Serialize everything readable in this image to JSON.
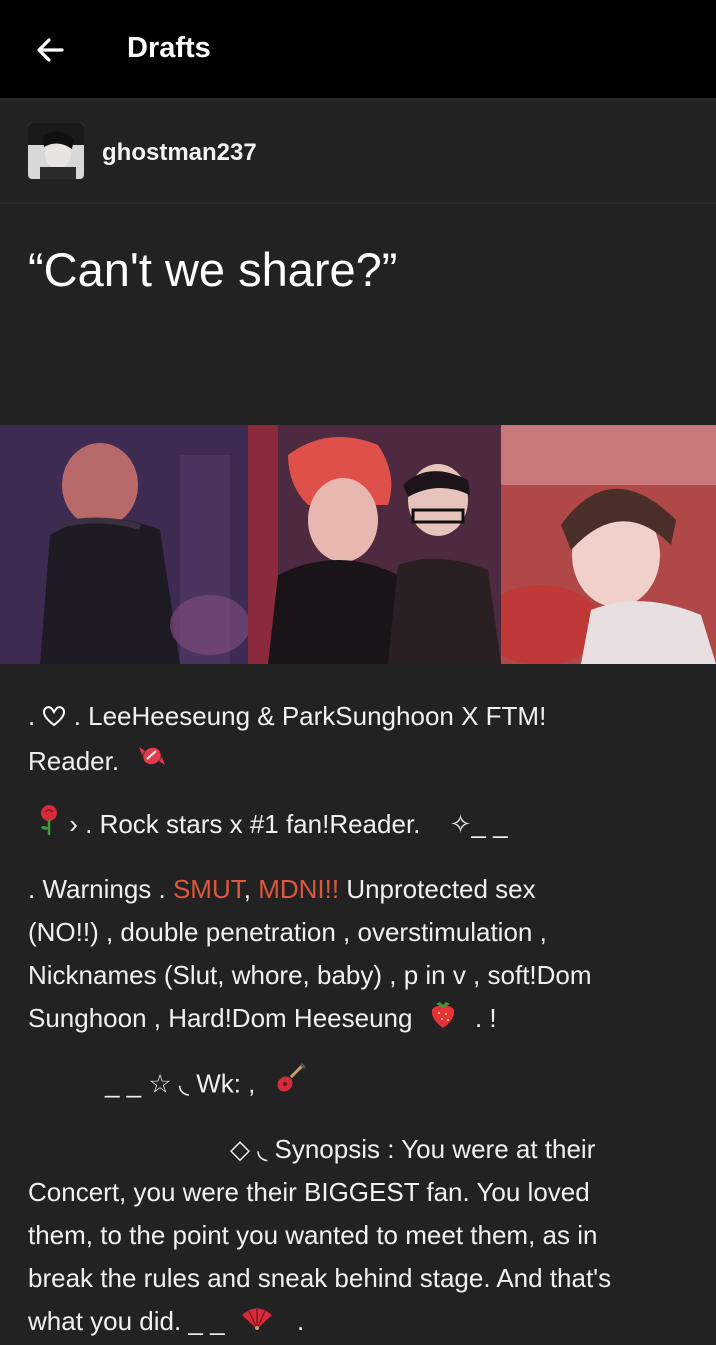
{
  "header": {
    "title": "Drafts",
    "back_icon": "arrow-left-icon"
  },
  "author": {
    "name": "ghostman237"
  },
  "post": {
    "title": "“Can't we share?”",
    "pairing_line_a": ". ",
    "pairing_line_b": " . LeeHeeseung & ParkSunghoon X FTM!",
    "pairing_line_c": "Reader.",
    "rock_line": " › . Rock stars x #1 fan!Reader.",
    "rock_suffix": "✧_ _",
    "warnings_lead": ". Warnings . ",
    "smut": "SMUT",
    "comma": ", ",
    "mdni": "MDNI!!",
    "warnings_rest_1": " Unprotected sex",
    "warnings_line_2": "(NO!!) , double penetration , overstimulation ,",
    "warnings_line_3": "Nicknames (Slut, whore, baby) , p in v , soft!Dom",
    "warnings_line_4": "Sunghoon , Hard!Dom Heeseung",
    "warnings_end": ". !",
    "wk_line": "_ _ ☆ ◟ Wk: ,",
    "synopsis_lead": "◇ ◟ Synopsis : You were at their",
    "synopsis_2": "Concert, you were their BIGGEST fan. You loved",
    "synopsis_3": "them, to the point you wanted to meet them, as in",
    "synopsis_4": "break the rules and sneak behind stage. And that's",
    "synopsis_5": "what you did. _ _",
    "synopsis_end": "."
  },
  "colors": {
    "background": "#222222",
    "topbar": "#000000",
    "accent_red": "#e0573d"
  },
  "icons": [
    "arrow-left-icon",
    "heart-outline-icon",
    "candy-icon",
    "rose-icon",
    "strawberry-icon",
    "guitar-icon",
    "fan-icon"
  ]
}
